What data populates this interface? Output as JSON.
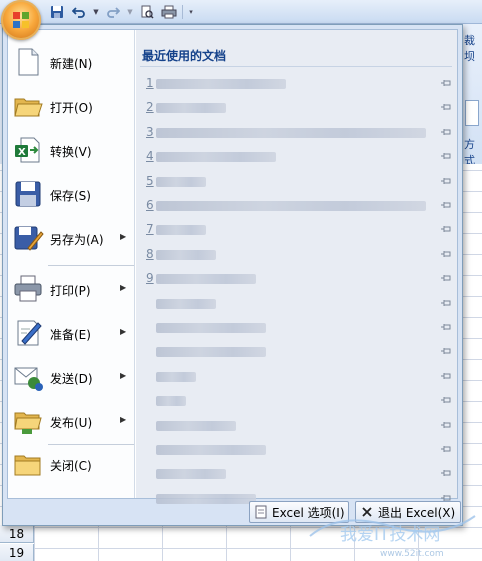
{
  "qat": {
    "icons": [
      "save-icon",
      "undo-icon",
      "redo-icon",
      "print-preview-icon",
      "quick-print-icon",
      "customize-qat-icon"
    ]
  },
  "ribbon": {
    "peek_top": "裁坝",
    "peek_bottom": "方式"
  },
  "menu": {
    "commands": [
      {
        "name": "new",
        "label": "新建(N)",
        "icon": "new-document-icon",
        "has_submenu": false
      },
      {
        "name": "open",
        "label": "打开(O)",
        "icon": "open-folder-icon",
        "has_submenu": false
      },
      {
        "name": "convert",
        "label": "转换(V)",
        "icon": "convert-icon",
        "has_submenu": false
      },
      {
        "name": "save",
        "label": "保存(S)",
        "icon": "save-disk-icon",
        "has_submenu": false
      },
      {
        "name": "save-as",
        "label": "另存为(A)",
        "icon": "save-as-icon",
        "has_submenu": true
      },
      {
        "name": "print",
        "label": "打印(P)",
        "icon": "printer-icon",
        "has_submenu": true
      },
      {
        "name": "prepare",
        "label": "准备(E)",
        "icon": "prepare-pen-icon",
        "has_submenu": true
      },
      {
        "name": "send",
        "label": "发送(D)",
        "icon": "send-icon",
        "has_submenu": true
      },
      {
        "name": "publish",
        "label": "发布(U)",
        "icon": "publish-icon",
        "has_submenu": true
      },
      {
        "name": "close",
        "label": "关闭(C)",
        "icon": "close-folder-icon",
        "has_submenu": false
      }
    ],
    "recent_title": "最近使用的文档",
    "recent_docs": [
      {
        "num": "1"
      },
      {
        "num": "2"
      },
      {
        "num": "3"
      },
      {
        "num": "4"
      },
      {
        "num": "5"
      },
      {
        "num": "6"
      },
      {
        "num": "7"
      },
      {
        "num": "8"
      },
      {
        "num": "9"
      },
      {
        "num": ""
      },
      {
        "num": ""
      },
      {
        "num": ""
      },
      {
        "num": ""
      },
      {
        "num": ""
      },
      {
        "num": ""
      },
      {
        "num": ""
      },
      {
        "num": ""
      },
      {
        "num": ""
      }
    ],
    "options_button": "Excel 选项(I)",
    "exit_button": "退出 Excel(X)"
  },
  "sheet": {
    "rows": [
      "18",
      "19"
    ]
  },
  "watermark": {
    "text": "我爱IT技术网",
    "url": "www.52it.com"
  },
  "colors": {
    "accent": "#15428b",
    "menu_bg": "#d7e3f4",
    "recent_bg": "#e8ecf3",
    "office_orange": "#f8a83c"
  }
}
